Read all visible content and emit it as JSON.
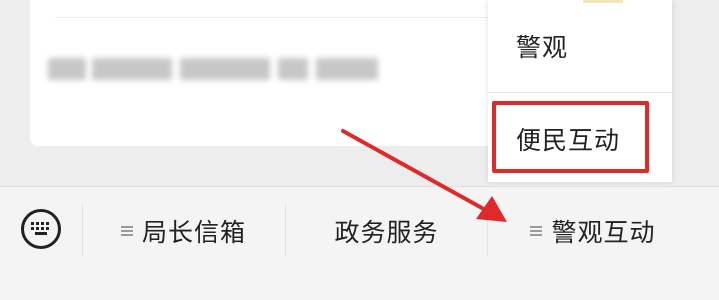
{
  "popup_menu": {
    "items": [
      {
        "label": "警观"
      },
      {
        "label": "便民互动"
      }
    ]
  },
  "bottom_bar": {
    "tabs": [
      {
        "label": "局长信箱",
        "has_submenu": true
      },
      {
        "label": "政务服务",
        "has_submenu": false
      },
      {
        "label": "警观互动",
        "has_submenu": true
      }
    ]
  },
  "annotation": {
    "highlight_color": "#e02a2a",
    "arrow_color": "#e02a2a"
  },
  "icons": [
    "keyboard-icon",
    "menu-lines-icon"
  ]
}
